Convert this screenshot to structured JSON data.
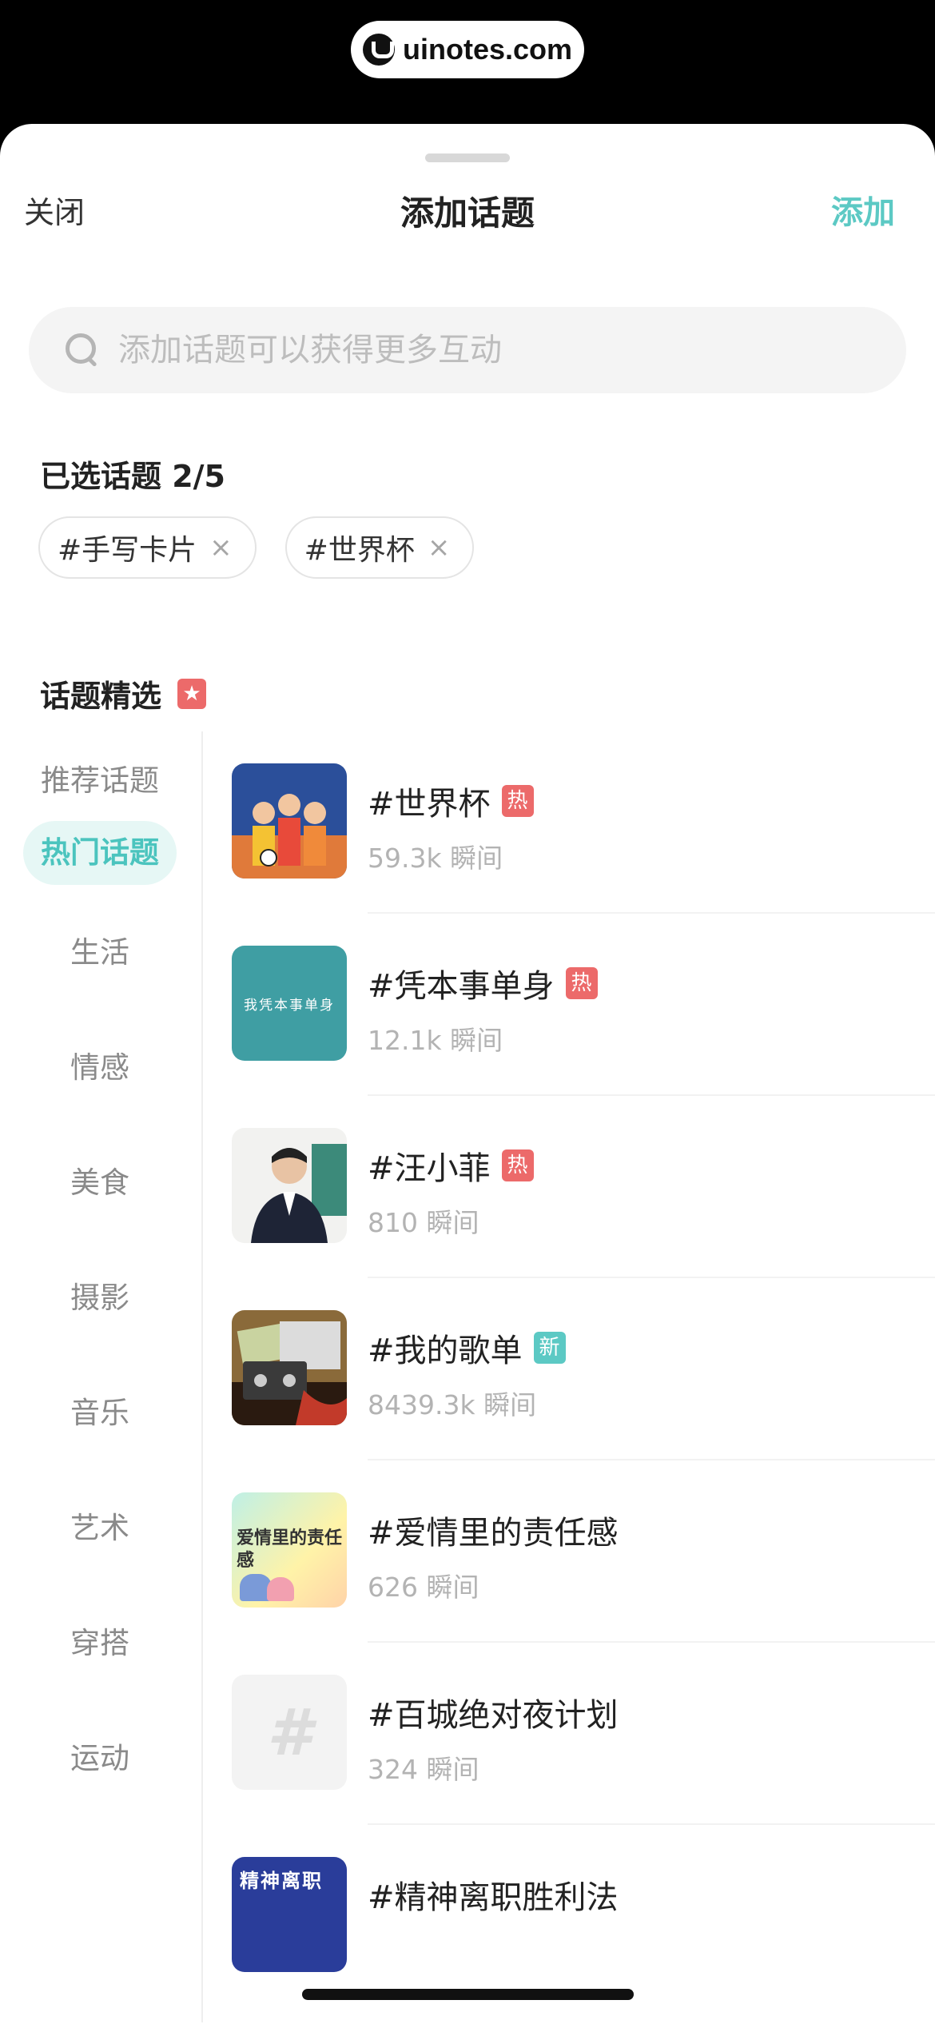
{
  "watermark": {
    "text": "uinotes.com",
    "icon": "uinotes-logo-icon"
  },
  "header": {
    "close_label": "关闭",
    "title": "添加话题",
    "add_label": "添加",
    "accent_color": "#5cc9c4"
  },
  "search": {
    "placeholder": "添加话题可以获得更多互动",
    "value": "",
    "icon": "search-icon"
  },
  "selected": {
    "title": "已选话题 2/5",
    "chips": [
      {
        "label": "#手写卡片",
        "remove": "×"
      },
      {
        "label": "#世界杯",
        "remove": "×"
      }
    ]
  },
  "featured": {
    "title": "话题精选",
    "icon_glyph": "★"
  },
  "categories": [
    {
      "label": "推荐话题",
      "active": false
    },
    {
      "label": "热门话题",
      "active": true
    },
    {
      "label": "生活",
      "active": false
    },
    {
      "label": "情感",
      "active": false
    },
    {
      "label": "美食",
      "active": false
    },
    {
      "label": "摄影",
      "active": false
    },
    {
      "label": "音乐",
      "active": false
    },
    {
      "label": "艺术",
      "active": false
    },
    {
      "label": "穿搭",
      "active": false
    },
    {
      "label": "运动",
      "active": false
    }
  ],
  "topics": [
    {
      "name": "#世界杯",
      "badge": "热",
      "badge_type": "hot",
      "count": "59.3k 瞬间",
      "thumb": "world-cup-fans-image"
    },
    {
      "name": "#凭本事单身",
      "badge": "热",
      "badge_type": "hot",
      "count": "12.1k 瞬间",
      "thumb": "teal-text-card-image",
      "thumb_text": "我凭本事单身"
    },
    {
      "name": "#汪小菲",
      "badge": "热",
      "badge_type": "hot",
      "count": "810 瞬间",
      "thumb": "portrait-man-suit-image"
    },
    {
      "name": "#我的歌单",
      "badge": "新",
      "badge_type": "new",
      "count": "8439.3k 瞬间",
      "thumb": "cassette-tapes-image"
    },
    {
      "name": "#爱情里的责任感",
      "badge": "",
      "badge_type": "",
      "count": "626 瞬间",
      "thumb": "love-responsibility-poster-image",
      "thumb_text": "爱情里的责任感"
    },
    {
      "name": "#百城绝对夜计划",
      "badge": "",
      "badge_type": "",
      "count": "324 瞬间",
      "thumb": "hash-placeholder-icon",
      "thumb_text": "#"
    },
    {
      "name": "#精神离职胜利法",
      "badge": "",
      "badge_type": "",
      "count": "",
      "thumb": "spiritual-resign-poster-image",
      "thumb_text": "精神离职"
    }
  ]
}
